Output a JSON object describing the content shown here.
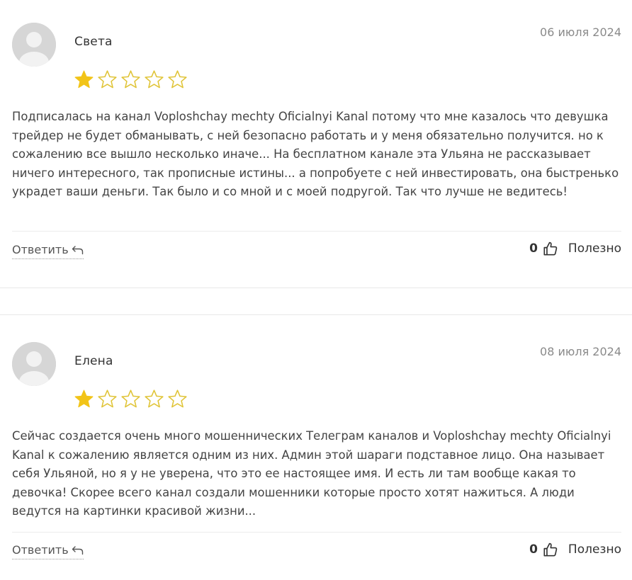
{
  "colors": {
    "star_filled": "#f2c418",
    "star_empty": "#e0c437",
    "avatar_bg": "#d6d6d6",
    "text": "#444444",
    "date": "#8a8a8a"
  },
  "reviews": [
    {
      "author": "Света",
      "date": "06 июля 2024",
      "rating": 1,
      "rating_max": 5,
      "text": "Подписалась на канал Voploshchay mechty Oficialnyi Kanal потому что мне казалось что девушка трейдер не будет обманывать, с ней безопасно работать и у меня обязательно получится. но к сожалению все вышло несколько иначе... На бесплатном канале эта Ульяна не рассказывает ничего интересного, так прописные истины... а попробуете с ней инвестировать, она быстренько украдет ваши деньги. Так было и со мной и с моей подругой. Так что лучше не ведитесь!",
      "reply_label": "Ответить",
      "helpful_count": "0",
      "helpful_label": "Полезно"
    },
    {
      "author": "Елена",
      "date": "08 июля 2024",
      "rating": 1,
      "rating_max": 5,
      "text": "Сейчас создается очень много мошеннических Телеграм каналов и Voploshchay mechty Oficialnyi Kanal к сожалению является одним из них. Админ этой шараги подставное лицо. Она называет себя Ульяной, но я у не уверена, что это ее настоящее имя. И есть ли там вообще какая то девочка! Скорее всего канал создали мошенники которые просто хотят нажиться. А люди ведутся на картинки красивой жизни...",
      "reply_label": "Ответить",
      "helpful_count": "0",
      "helpful_label": "Полезно"
    }
  ]
}
